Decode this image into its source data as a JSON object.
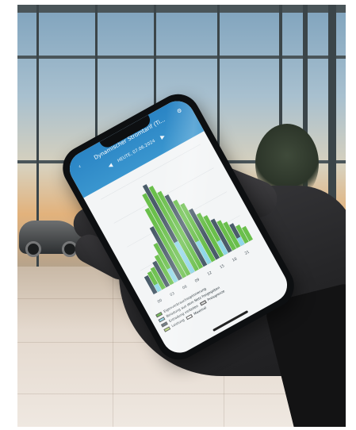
{
  "app": {
    "title": "Dynamischer Stromtarif (Ti...",
    "date_label": "HEUTE, 07.06.2024"
  },
  "legend": {
    "items": [
      {
        "label": "Eigenverbrauchsoptimierung",
        "color": "#6abf4b"
      },
      {
        "label": "Beladung aus dem Netz freigegeben",
        "color": "#8fd7e8"
      },
      {
        "label": "Entladung verboten",
        "color": "#5a6a75"
      },
      {
        "label": "Preisgrenze",
        "color": "#d9d9d9"
      },
      {
        "label": "Leistung",
        "color": "#b5d96b"
      }
    ],
    "extra": "Maximal"
  },
  "chart_data": {
    "type": "bar",
    "categories": [
      "00",
      "01",
      "02",
      "03",
      "04",
      "05",
      "06",
      "07",
      "08",
      "09",
      "10",
      "11",
      "12",
      "13",
      "14",
      "15",
      "16",
      "17",
      "18",
      "19",
      "20",
      "21",
      "22",
      "23"
    ],
    "series": [
      {
        "values": [
          18,
          20,
          22,
          26,
          30,
          40,
          55,
          72,
          85,
          92,
          88,
          80,
          74,
          66,
          60,
          52,
          45,
          40,
          34,
          30,
          26,
          22,
          18,
          14
        ]
      }
    ]
  },
  "colors": {
    "header": "#2a84c4",
    "bar_green": "#6abf4b",
    "bar_dark": "#4a5c6a",
    "bar_cyan": "#8fd7e8"
  }
}
